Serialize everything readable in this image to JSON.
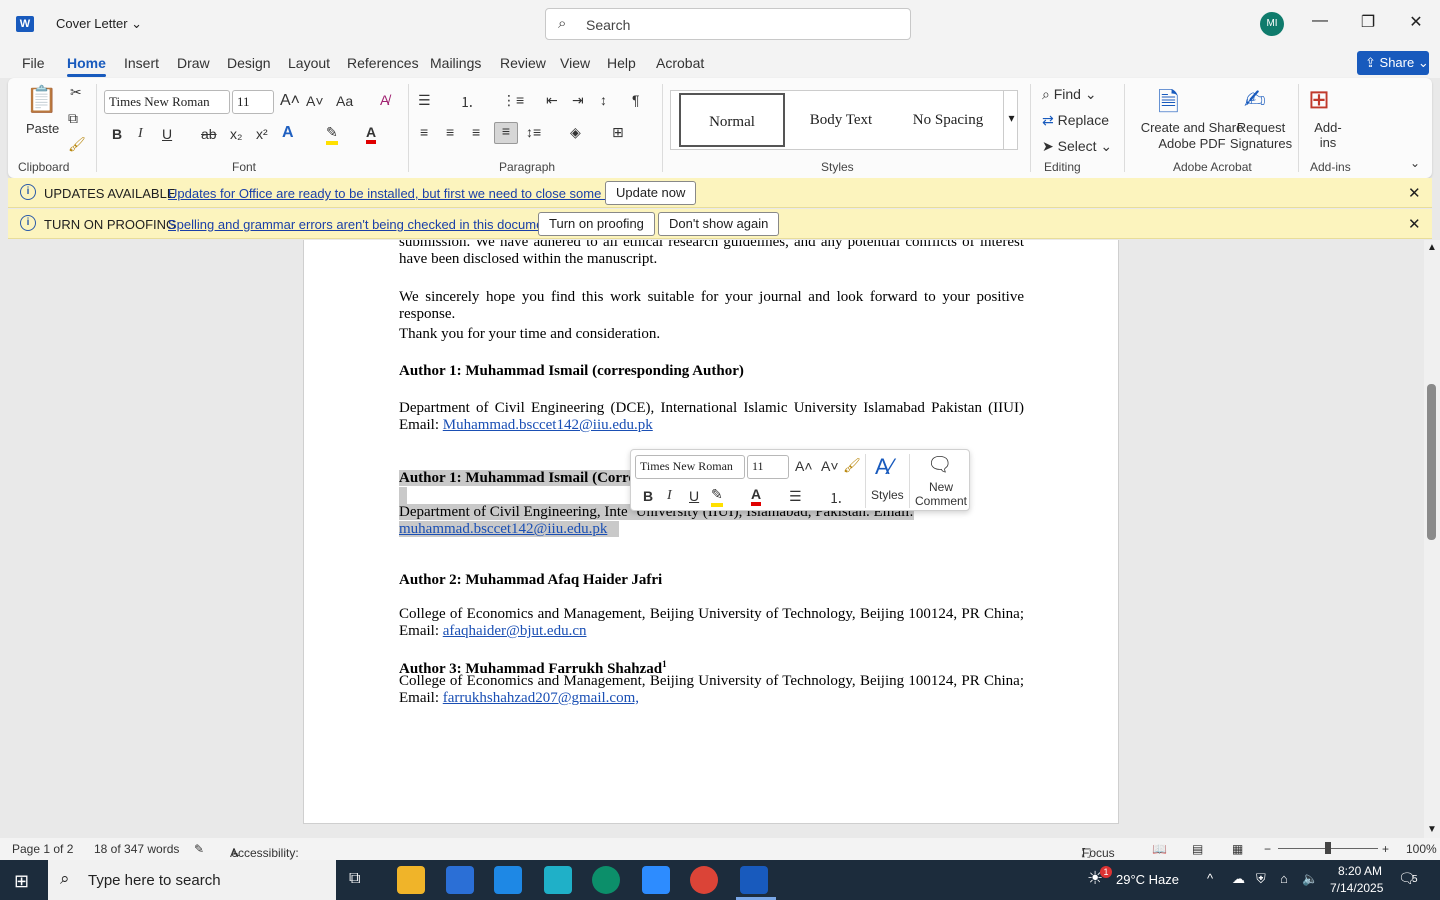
{
  "title_bar": {
    "app_icon": "word-icon",
    "doc_title": "Cover Letter",
    "search_placeholder": "Search",
    "avatar_initials": "MI"
  },
  "menu": {
    "tabs": [
      "File",
      "Home",
      "Insert",
      "Draw",
      "Design",
      "Layout",
      "References",
      "Mailings",
      "Review",
      "View",
      "Help",
      "Acrobat"
    ],
    "active_tab": "Home",
    "share_label": "Share"
  },
  "ribbon": {
    "clipboard": {
      "paste_label": "Paste",
      "group_label": "Clipboard"
    },
    "font": {
      "font_name": "Times New Roman",
      "font_size": "11",
      "group_label": "Font"
    },
    "paragraph": {
      "group_label": "Paragraph"
    },
    "styles": {
      "items": [
        "Normal",
        "Body Text",
        "No Spacing"
      ],
      "group_label": "Styles"
    },
    "editing": {
      "find": "Find",
      "replace": "Replace",
      "select": "Select",
      "group_label": "Editing"
    },
    "acrobat": {
      "create_share": "Create and Share",
      "adobe_pdf": "Adobe PDF",
      "request": "Request",
      "signatures": "Signatures",
      "group_label": "Adobe Acrobat"
    },
    "addins": {
      "label": "Add-ins",
      "group_label": "Add-ins"
    }
  },
  "messages": [
    {
      "title": "UPDATES AVAILABLE",
      "text": "Updates for Office are ready to be installed, but first we need to close some apps.",
      "buttons": [
        "Update now"
      ]
    },
    {
      "title": "TURN ON PROOFING",
      "text": "Spelling and grammar errors aren't being checked in this document.",
      "buttons": [
        "Turn on proofing",
        "Don't show again"
      ]
    }
  ],
  "document": {
    "p1": "submission. We have adhered to all ethical research guidelines, and any potential conflicts of interest have been disclosed within the manuscript.",
    "p2": "We sincerely hope you find this work suitable for your journal and look forward to your positive response.",
    "p3": "Thank you for your time and consideration.",
    "a1_head": "Author 1: Muhammad Ismail (corresponding Author)",
    "a1_dept": "Department of Civil Engineering (DCE), International Islamic University Islamabad Pakistan (IIUI)  Email: ",
    "a1_email": "Muhammad.bsccet142@iiu.edu.pk",
    "sel_head": "Author 1: Muhammad Ismail (Corre",
    "sel_dept_a": "Department of Civil Engineering, Inte",
    "sel_dept_b": "University (IIUI), Islamabad, Pakistan. Email:",
    "sel_email": "muhammad.bsccet142@iiu.edu.pk",
    "a2_head": "Author 2: Muhammad Afaq Haider Jafri",
    "a2_aff": "College of Economics and Management, Beijing University of Technology, Beijing 100124, PR China; Email: ",
    "a2_email": "afaqhaider@bjut.edu.cn",
    "a3_head": "Author 3: Muhammad Farrukh Shahzad",
    "a3_sup": "1",
    "a3_aff": "College of Economics and Management, Beijing University of Technology, Beijing 100124, PR China; Email: ",
    "a3_email": "farrukhshahzad207@gmail.com,"
  },
  "mini_toolbar": {
    "font_name": "Times New Roman",
    "font_size": "11",
    "styles_label": "Styles",
    "new_label": "New",
    "comment_label": "Comment"
  },
  "status_bar": {
    "page": "Page 1 of 2",
    "words": "18 of 347 words",
    "accessibility": "Accessibility: Good to go",
    "focus": "Focus",
    "zoom": "100%"
  },
  "taskbar": {
    "search_placeholder": "Type here to search",
    "weather": "29°C  Haze",
    "time": "8:20 AM",
    "date": "7/14/2025",
    "notifications": "5",
    "weather_badge": "1"
  },
  "colors": {
    "accent": "#185abd",
    "message_bar": "#fcf4be",
    "link": "#1a4fb4"
  }
}
